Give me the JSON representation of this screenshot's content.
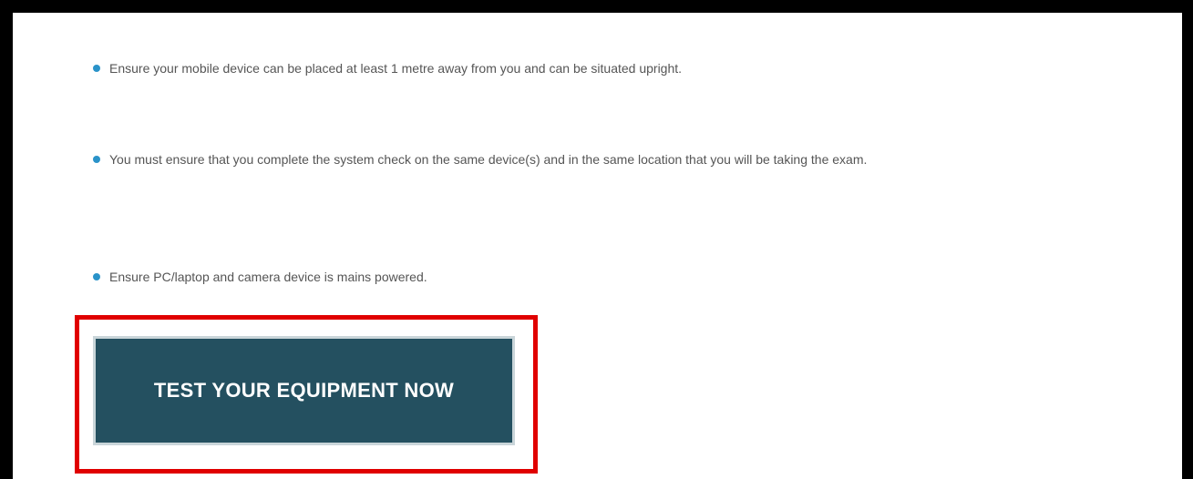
{
  "bullets": [
    {
      "text": "Ensure your mobile device can be placed at least 1 metre away from you and can be situated upright."
    },
    {
      "text": "You must ensure that you complete the system check on the same device(s) and in the same location that you will be taking the exam."
    },
    {
      "text": "Ensure PC/laptop and camera device is mains powered."
    }
  ],
  "cta": {
    "label": "TEST YOUR EQUIPMENT NOW"
  },
  "colors": {
    "bullet": "#2a93c9",
    "button_bg": "#245060",
    "highlight_border": "#e00000",
    "text": "#555555"
  }
}
